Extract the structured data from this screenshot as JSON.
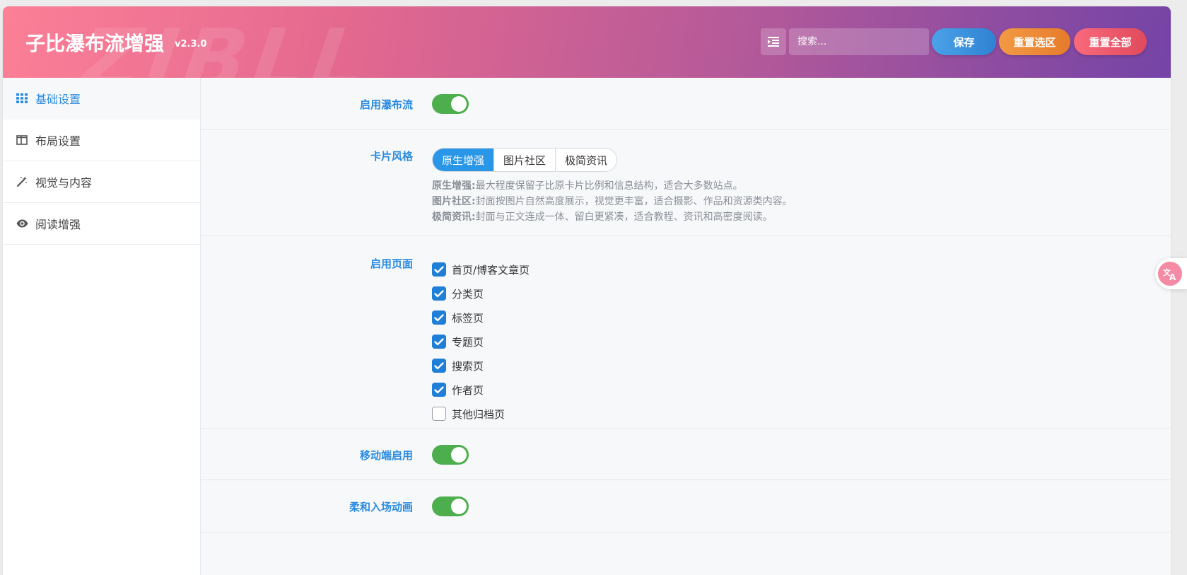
{
  "header": {
    "title": "子比瀑布流增强",
    "version": "v2.3.0",
    "watermark": "ZIBLL",
    "search_placeholder": "搜索...",
    "save_label": "保存",
    "reset_section_label": "重置选区",
    "reset_all_label": "重置全部"
  },
  "sidebar": {
    "items": [
      {
        "label": "基础设置",
        "icon": "grid-icon",
        "active": true
      },
      {
        "label": "布局设置",
        "icon": "columns-icon",
        "active": false
      },
      {
        "label": "视觉与内容",
        "icon": "magic-wand-icon",
        "active": false
      },
      {
        "label": "阅读增强",
        "icon": "eye-icon",
        "active": false
      }
    ]
  },
  "settings": {
    "enable_waterfall": {
      "label": "启用瀑布流",
      "value": true
    },
    "card_style": {
      "label": "卡片风格",
      "options": [
        "原生增强",
        "图片社区",
        "极简资讯"
      ],
      "selected": "原生增强",
      "descriptions": [
        {
          "name": "原生增强:",
          "text": "最大程度保留子比原卡片比例和信息结构，适合大多数站点。"
        },
        {
          "name": "图片社区:",
          "text": "封面按图片自然高度展示，视觉更丰富，适合摄影、作品和资源类内容。"
        },
        {
          "name": "极简资讯:",
          "text": "封面与正文连成一体、留白更紧凑，适合教程、资讯和高密度阅读。"
        }
      ]
    },
    "enabled_pages": {
      "label": "启用页面",
      "items": [
        {
          "label": "首页/博客文章页",
          "checked": true
        },
        {
          "label": "分类页",
          "checked": true
        },
        {
          "label": "标签页",
          "checked": true
        },
        {
          "label": "专题页",
          "checked": true
        },
        {
          "label": "搜索页",
          "checked": true
        },
        {
          "label": "作者页",
          "checked": true
        },
        {
          "label": "其他归档页",
          "checked": false
        }
      ]
    },
    "mobile_enable": {
      "label": "移动端启用",
      "value": true
    },
    "soft_entrance_animation": {
      "label": "柔和入场动画",
      "value": true
    }
  },
  "colors": {
    "accent": "#2a8be0",
    "toggle_on": "#4cae4c",
    "header_gradient_start": "#fc7f97",
    "header_gradient_end": "#7444a6"
  }
}
